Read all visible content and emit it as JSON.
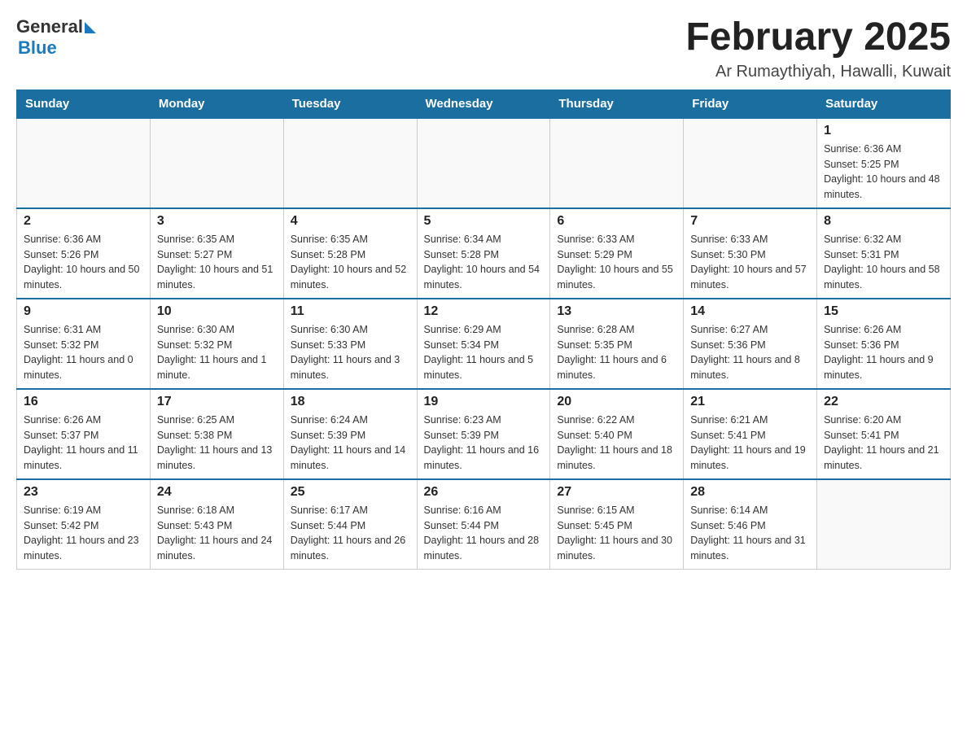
{
  "header": {
    "logo": {
      "general": "General",
      "arrow": "▶",
      "blue": "Blue"
    },
    "title": "February 2025",
    "location": "Ar Rumaythiyah, Hawalli, Kuwait"
  },
  "days_of_week": [
    "Sunday",
    "Monday",
    "Tuesday",
    "Wednesday",
    "Thursday",
    "Friday",
    "Saturday"
  ],
  "weeks": [
    [
      {
        "day": "",
        "info": ""
      },
      {
        "day": "",
        "info": ""
      },
      {
        "day": "",
        "info": ""
      },
      {
        "day": "",
        "info": ""
      },
      {
        "day": "",
        "info": ""
      },
      {
        "day": "",
        "info": ""
      },
      {
        "day": "1",
        "info": "Sunrise: 6:36 AM\nSunset: 5:25 PM\nDaylight: 10 hours and 48 minutes."
      }
    ],
    [
      {
        "day": "2",
        "info": "Sunrise: 6:36 AM\nSunset: 5:26 PM\nDaylight: 10 hours and 50 minutes."
      },
      {
        "day": "3",
        "info": "Sunrise: 6:35 AM\nSunset: 5:27 PM\nDaylight: 10 hours and 51 minutes."
      },
      {
        "day": "4",
        "info": "Sunrise: 6:35 AM\nSunset: 5:28 PM\nDaylight: 10 hours and 52 minutes."
      },
      {
        "day": "5",
        "info": "Sunrise: 6:34 AM\nSunset: 5:28 PM\nDaylight: 10 hours and 54 minutes."
      },
      {
        "day": "6",
        "info": "Sunrise: 6:33 AM\nSunset: 5:29 PM\nDaylight: 10 hours and 55 minutes."
      },
      {
        "day": "7",
        "info": "Sunrise: 6:33 AM\nSunset: 5:30 PM\nDaylight: 10 hours and 57 minutes."
      },
      {
        "day": "8",
        "info": "Sunrise: 6:32 AM\nSunset: 5:31 PM\nDaylight: 10 hours and 58 minutes."
      }
    ],
    [
      {
        "day": "9",
        "info": "Sunrise: 6:31 AM\nSunset: 5:32 PM\nDaylight: 11 hours and 0 minutes."
      },
      {
        "day": "10",
        "info": "Sunrise: 6:30 AM\nSunset: 5:32 PM\nDaylight: 11 hours and 1 minute."
      },
      {
        "day": "11",
        "info": "Sunrise: 6:30 AM\nSunset: 5:33 PM\nDaylight: 11 hours and 3 minutes."
      },
      {
        "day": "12",
        "info": "Sunrise: 6:29 AM\nSunset: 5:34 PM\nDaylight: 11 hours and 5 minutes."
      },
      {
        "day": "13",
        "info": "Sunrise: 6:28 AM\nSunset: 5:35 PM\nDaylight: 11 hours and 6 minutes."
      },
      {
        "day": "14",
        "info": "Sunrise: 6:27 AM\nSunset: 5:36 PM\nDaylight: 11 hours and 8 minutes."
      },
      {
        "day": "15",
        "info": "Sunrise: 6:26 AM\nSunset: 5:36 PM\nDaylight: 11 hours and 9 minutes."
      }
    ],
    [
      {
        "day": "16",
        "info": "Sunrise: 6:26 AM\nSunset: 5:37 PM\nDaylight: 11 hours and 11 minutes."
      },
      {
        "day": "17",
        "info": "Sunrise: 6:25 AM\nSunset: 5:38 PM\nDaylight: 11 hours and 13 minutes."
      },
      {
        "day": "18",
        "info": "Sunrise: 6:24 AM\nSunset: 5:39 PM\nDaylight: 11 hours and 14 minutes."
      },
      {
        "day": "19",
        "info": "Sunrise: 6:23 AM\nSunset: 5:39 PM\nDaylight: 11 hours and 16 minutes."
      },
      {
        "day": "20",
        "info": "Sunrise: 6:22 AM\nSunset: 5:40 PM\nDaylight: 11 hours and 18 minutes."
      },
      {
        "day": "21",
        "info": "Sunrise: 6:21 AM\nSunset: 5:41 PM\nDaylight: 11 hours and 19 minutes."
      },
      {
        "day": "22",
        "info": "Sunrise: 6:20 AM\nSunset: 5:41 PM\nDaylight: 11 hours and 21 minutes."
      }
    ],
    [
      {
        "day": "23",
        "info": "Sunrise: 6:19 AM\nSunset: 5:42 PM\nDaylight: 11 hours and 23 minutes."
      },
      {
        "day": "24",
        "info": "Sunrise: 6:18 AM\nSunset: 5:43 PM\nDaylight: 11 hours and 24 minutes."
      },
      {
        "day": "25",
        "info": "Sunrise: 6:17 AM\nSunset: 5:44 PM\nDaylight: 11 hours and 26 minutes."
      },
      {
        "day": "26",
        "info": "Sunrise: 6:16 AM\nSunset: 5:44 PM\nDaylight: 11 hours and 28 minutes."
      },
      {
        "day": "27",
        "info": "Sunrise: 6:15 AM\nSunset: 5:45 PM\nDaylight: 11 hours and 30 minutes."
      },
      {
        "day": "28",
        "info": "Sunrise: 6:14 AM\nSunset: 5:46 PM\nDaylight: 11 hours and 31 minutes."
      },
      {
        "day": "",
        "info": ""
      }
    ]
  ]
}
